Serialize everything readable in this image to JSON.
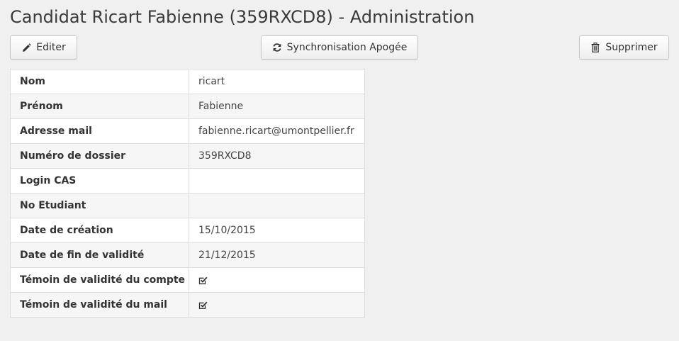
{
  "page": {
    "title": "Candidat Ricart Fabienne (359RXCD8) - Administration"
  },
  "toolbar": {
    "edit_label": "Editer",
    "edit_icon": "pencil-icon",
    "sync_label": "Synchronisation Apogée",
    "sync_icon": "refresh-icon",
    "delete_label": "Supprimer",
    "delete_icon": "trash-icon"
  },
  "details": {
    "rows": [
      {
        "label": "Nom",
        "value": "ricart"
      },
      {
        "label": "Prénom",
        "value": "Fabienne"
      },
      {
        "label": "Adresse mail",
        "value": "fabienne.ricart@umontpellier.fr"
      },
      {
        "label": "Numéro de dossier",
        "value": "359RXCD8"
      },
      {
        "label": "Login CAS",
        "value": ""
      },
      {
        "label": "No Etudiant",
        "value": ""
      },
      {
        "label": "Date de création",
        "value": "15/10/2015"
      },
      {
        "label": "Date de fin de validité",
        "value": "21/12/2015"
      },
      {
        "label": "Témoin de validité du compte",
        "checked": true,
        "icon": "checked-checkbox-icon"
      },
      {
        "label": "Témoin de validité du mail",
        "checked": true,
        "icon": "checked-checkbox-icon"
      }
    ]
  }
}
